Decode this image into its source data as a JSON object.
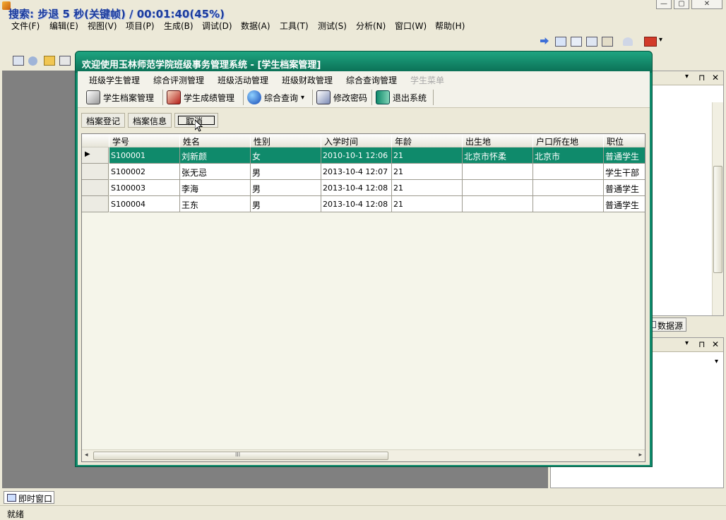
{
  "ide": {
    "search_overlay": "搜索: 步退 5 秒(关键帧) / 00:01:40(45%)",
    "menu": [
      "文件(F)",
      "编辑(E)",
      "视图(V)",
      "项目(P)",
      "生成(B)",
      "调试(D)",
      "数据(A)",
      "工具(T)",
      "测试(S)",
      "分析(N)",
      "窗口(W)",
      "帮助(H)"
    ],
    "window_buttons": [
      "—",
      "▢",
      "✕"
    ],
    "datasource_tab": "数据源",
    "immediate_tab": "即时窗口",
    "status": "就绪",
    "arrows": {
      "down": "▾",
      "pin": "⊓",
      "close": "✕"
    }
  },
  "app": {
    "title": "欢迎使用玉林师范学院班级事务管理系统 - [学生档案管理]",
    "menu": [
      "班级学生管理",
      "综合评测管理",
      "班级活动管理",
      "班级财政管理",
      "综合查询管理",
      "学生菜单"
    ],
    "toolbar": [
      "学生档案管理",
      "学生成绩管理",
      "综合查询",
      "修改密码",
      "退出系统"
    ],
    "dropdown_arrow": "▾",
    "subtoolbar": [
      "档案登记",
      "档案信息",
      "取消"
    ]
  },
  "grid": {
    "columns": [
      "学号",
      "姓名",
      "性别",
      "入学时间",
      "年龄",
      "出生地",
      "户口所在地",
      "职位"
    ],
    "rows": [
      [
        "S100001",
        "刘新颜",
        "女",
        "2010-10-1 12:06",
        "21",
        "北京市怀柔",
        "北京市",
        "普通学生"
      ],
      [
        "S100002",
        "张无忌",
        "男",
        "2013-10-4 12:07",
        "21",
        "",
        "",
        "学生干部"
      ],
      [
        "S100003",
        "李海",
        "男",
        "2013-10-4 12:08",
        "21",
        "",
        "",
        "普通学生"
      ],
      [
        "S100004",
        "王东",
        "男",
        "2013-10-4 12:08",
        "21",
        "",
        "",
        "普通学生"
      ]
    ],
    "selected_row": 0,
    "current_marker": "▶",
    "scroll": {
      "left": "◂",
      "right": "▸",
      "grip": "III"
    }
  },
  "colors": {
    "accent": "#0f8a6b",
    "ide_bg": "#ece9d8",
    "workspace": "#808080"
  }
}
